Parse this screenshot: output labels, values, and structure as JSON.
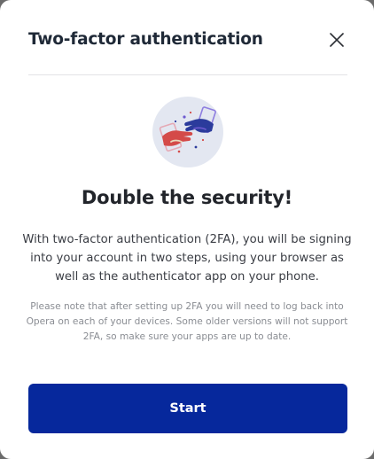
{
  "dialog": {
    "title": "Two-factor authentication",
    "close_icon": "close-icon",
    "illustration_icon": "two-hands-handshake-illustration",
    "headline": "Double the security!",
    "description": "With two-factor authentication (2FA), you will be signing into your account in two steps, using your browser as well as the authenticator app on your phone.",
    "note": "Please note that after setting up 2FA you will need to log back into Opera on each of your devices. Some older versions will not support 2FA, so make sure your apps are up to date.",
    "start_label": "Start"
  },
  "colors": {
    "primary_button": "#06289c",
    "title_text": "#1f2937",
    "note_text": "#8a8d93",
    "illustration_bg": "#e3e7f1",
    "illustration_red": "#d44a48",
    "illustration_blue": "#2b3b9c",
    "illustration_purple": "#6e5ad0"
  }
}
